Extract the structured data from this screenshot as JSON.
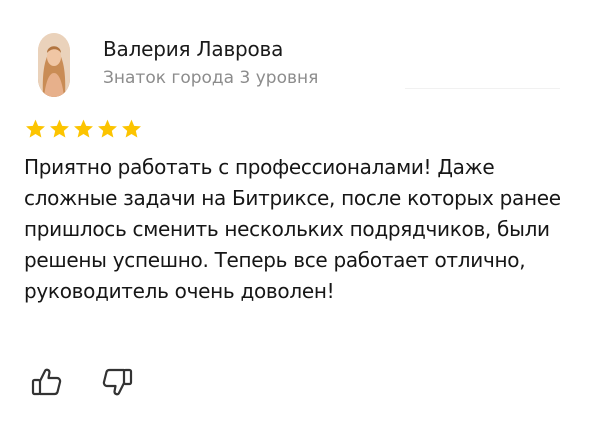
{
  "review": {
    "author_name": "Валерия Лаврова",
    "author_level": "Знаток города 3 уровня",
    "rating": 5,
    "text": "Приятно работать с профессионалами! Даже сложные задачи на Битриксе, после которых ранее пришлось сменить нескольких подрядчиков, были решены успешно. Теперь все работает отлично, руководитель очень доволен!"
  },
  "actions": {
    "like_icon": "thumb-up-icon",
    "dislike_icon": "thumb-down-icon"
  },
  "colors": {
    "star": "#fcc400",
    "text": "#161616",
    "muted": "#8c8c8c",
    "icon": "#333333"
  }
}
